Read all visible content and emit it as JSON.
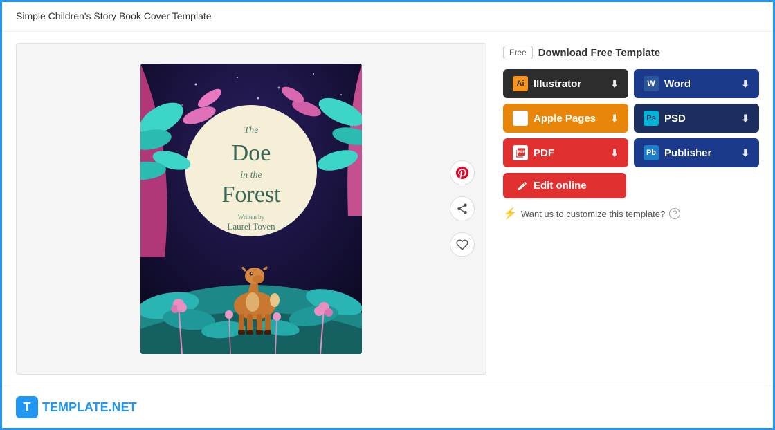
{
  "header": {
    "title": "Simple Children's Story Book Cover Template"
  },
  "badge": {
    "free_label": "Free",
    "download_label": "Download Free Template"
  },
  "buttons": {
    "illustrator": "Illustrator",
    "word": "Word",
    "apple_pages": "Apple Pages",
    "psd": "PSD",
    "pdf": "PDF",
    "publisher": "Publisher",
    "edit_online": "Edit online",
    "customize": "Want us to customize this template?"
  },
  "book": {
    "title_the": "The",
    "title_doe": "Doe",
    "title_in_the": "in the",
    "title_forest": "Forest",
    "written_by": "Written by",
    "author": "Laurel Toven"
  },
  "footer": {
    "logo_letter": "T",
    "brand_name": "TEMPLATE",
    "brand_suffix": ".NET"
  },
  "icons": {
    "pinterest": "⊕",
    "share": "⊘",
    "heart": "♡"
  }
}
